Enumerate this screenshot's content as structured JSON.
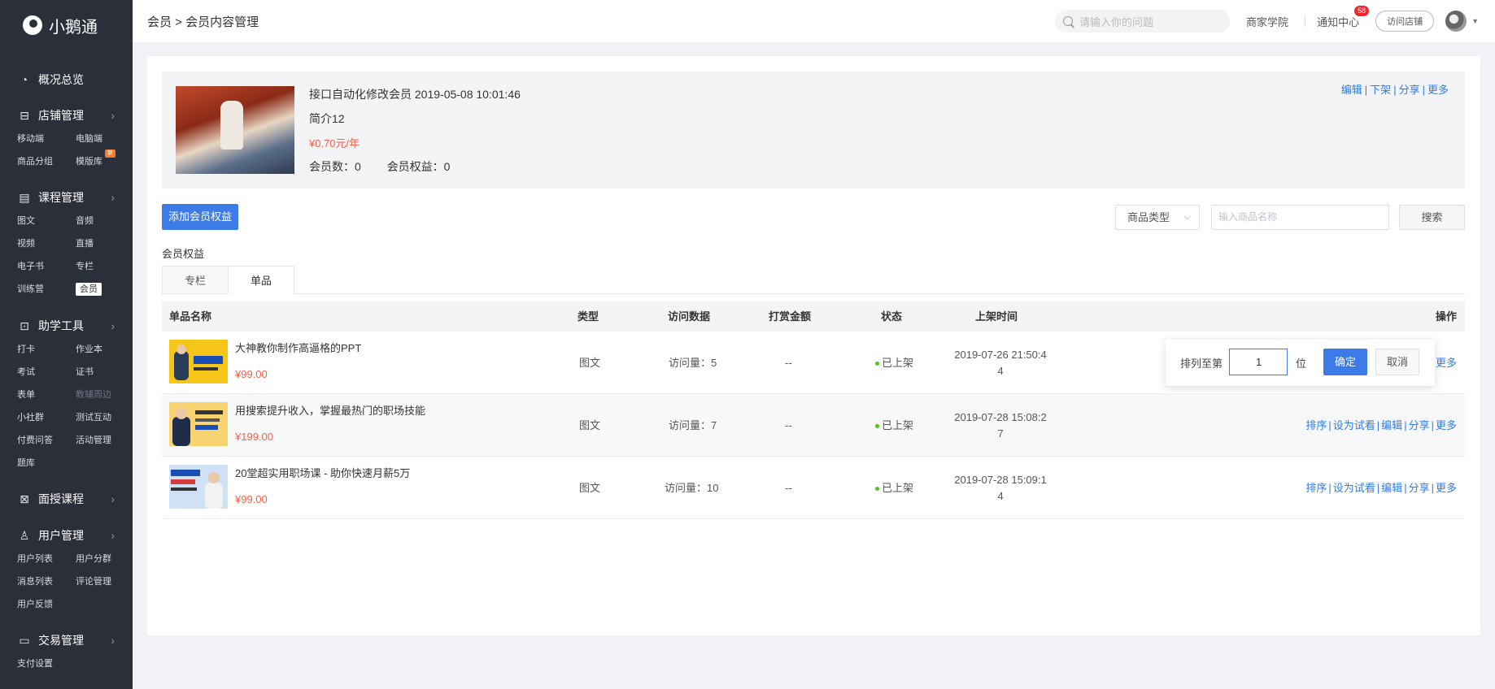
{
  "app": {
    "name": "小鹅通"
  },
  "sidebar": {
    "groups": [
      {
        "label": "概况总览",
        "icon": "pie-chart-icon",
        "items": []
      },
      {
        "label": "店铺管理",
        "icon": "store-icon",
        "items": [
          "移动端",
          "电脑端",
          "商品分组",
          "模版库"
        ],
        "badge": "新"
      },
      {
        "label": "课程管理",
        "icon": "book-icon",
        "items": [
          "图文",
          "音频",
          "视频",
          "直播",
          "电子书",
          "专栏",
          "训练营",
          "会员"
        ]
      },
      {
        "label": "助学工具",
        "icon": "toolbox-icon",
        "items": [
          "打卡",
          "作业本",
          "考试",
          "证书",
          "表单",
          "教辅周边",
          "小社群",
          "测试互动",
          "付费问答",
          "活动管理",
          "题库"
        ]
      },
      {
        "label": "面授课程",
        "icon": "teach-icon",
        "items": []
      },
      {
        "label": "用户管理",
        "icon": "user-icon",
        "items": [
          "用户列表",
          "用户分群",
          "消息列表",
          "评论管理",
          "用户反馈"
        ]
      },
      {
        "label": "交易管理",
        "icon": "wallet-icon",
        "items": [
          "支付设置"
        ]
      }
    ]
  },
  "topbar": {
    "breadcrumb": "会员 > 会员内容管理",
    "search_placeholder": "请输入你的问题",
    "academy": "商家学院",
    "notice": "通知中心",
    "notice_count": "58",
    "visit_store": "访问店铺"
  },
  "member": {
    "title": "接口自动化修改会员 2019-05-08 10:01:46",
    "intro": "简介12",
    "price": "¥0.70元/年",
    "member_count": "会员数：0",
    "rights_count": "会员权益：0",
    "actions": [
      "编辑",
      "下架",
      "分享",
      "更多"
    ]
  },
  "toolbar": {
    "add_label": "添加会员权益",
    "type_select": "商品类型",
    "name_placeholder": "输入商品名称",
    "search_label": "搜索"
  },
  "section_label": "会员权益",
  "tabs": [
    "专栏",
    "单品"
  ],
  "table": {
    "headers": [
      "单品名称",
      "类型",
      "访问数据",
      "打赏金额",
      "状态",
      "上架时间",
      "操作"
    ],
    "rows": [
      {
        "title": "大神教你制作高逼格的PPT",
        "price": "¥99.00",
        "type": "图文",
        "visits": "访问量：5",
        "reward": "--",
        "status": "已上架",
        "time1": "2019-07-26 21:50:4",
        "time2": "4",
        "ops": [
          "更多"
        ]
      },
      {
        "title": "用搜索提升收入，掌握最热门的职场技能",
        "price": "¥199.00",
        "type": "图文",
        "visits": "访问量：7",
        "reward": "--",
        "status": "已上架",
        "time1": "2019-07-28 15:08:2",
        "time2": "7",
        "ops": [
          "排序",
          "设为试看",
          "编辑",
          "分享",
          "更多"
        ]
      },
      {
        "title": "20堂超实用职场课 - 助你快速月薪5万",
        "price": "¥99.00",
        "type": "图文",
        "visits": "访问量：10",
        "reward": "--",
        "status": "已上架",
        "time1": "2019-07-28 15:09:1",
        "time2": "4",
        "ops": [
          "排序",
          "设为试看",
          "编辑",
          "分享",
          "更多"
        ]
      }
    ]
  },
  "sort_popover": {
    "label": "排列至第",
    "value": "1",
    "unit": "位",
    "confirm": "确定",
    "cancel": "取消"
  }
}
